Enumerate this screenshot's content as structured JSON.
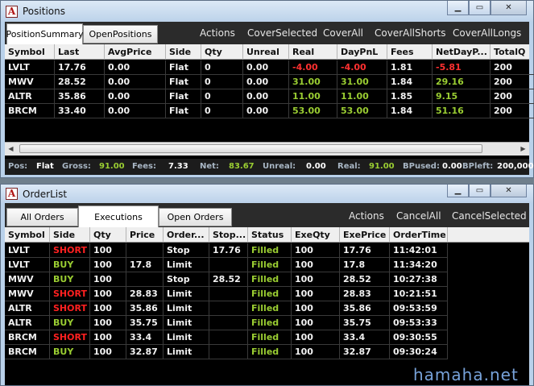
{
  "positions_window": {
    "title": "Positions",
    "tabs": [
      "PositionSummary",
      "OpenPositions"
    ],
    "actions": [
      "Actions",
      "CoverSelected",
      "CoverAll",
      "CoverAllShorts",
      "CoverAllLongs"
    ],
    "columns": [
      "Symbol",
      "Last",
      "AvgPrice",
      "Side",
      "Qty",
      "Unreal",
      "Real",
      "DayPnL",
      "Fees",
      "NetDayP...",
      "TotalQ"
    ],
    "rows": [
      [
        "LVLT",
        "17.76",
        "0.00",
        "Flat",
        "0",
        "0.00",
        "-4.00",
        "-4.00",
        "1.81",
        "-5.81",
        "200"
      ],
      [
        "MWV",
        "28.52",
        "0.00",
        "Flat",
        "0",
        "0.00",
        "31.00",
        "31.00",
        "1.84",
        "29.16",
        "200"
      ],
      [
        "ALTR",
        "35.86",
        "0.00",
        "Flat",
        "0",
        "0.00",
        "11.00",
        "11.00",
        "1.85",
        "9.15",
        "200"
      ],
      [
        "BRCM",
        "33.40",
        "0.00",
        "Flat",
        "0",
        "0.00",
        "53.00",
        "53.00",
        "1.84",
        "51.16",
        "200"
      ]
    ],
    "status": {
      "pos_label": "Pos:",
      "pos_value": "Flat",
      "gross_label": "Gross:",
      "gross_value": "91.00",
      "fees_label": "Fees:",
      "fees_value": "7.33",
      "net_label": "Net:",
      "net_value": "83.67",
      "unreal_label": "Unreal:",
      "unreal_value": "0.00",
      "real_label": "Real:",
      "real_value": "91.00",
      "bpused_label": "BPused:",
      "bpused_value": "0.00",
      "bpleft_label": "BPleft:",
      "bpleft_value": "200,000"
    }
  },
  "orders_window": {
    "title": "OrderList",
    "tabs": [
      "All Orders",
      "Executions",
      "Open Orders"
    ],
    "actions": [
      "Actions",
      "CancelAll",
      "CancelSelected"
    ],
    "columns": [
      "Symbol",
      "Side",
      "Qty",
      "Price",
      "Order...",
      "Stop...",
      "Status",
      "ExeQty",
      "ExePrice",
      "OrderTime"
    ],
    "rows": [
      [
        "LVLT",
        "SHORT",
        "100",
        "",
        "Stop",
        "17.76",
        "Filled",
        "100",
        "17.76",
        "11:42:01"
      ],
      [
        "LVLT",
        "BUY",
        "100",
        "17.8",
        "Limit",
        "",
        "Filled",
        "100",
        "17.8",
        "11:34:20"
      ],
      [
        "MWV",
        "BUY",
        "100",
        "",
        "Stop",
        "28.52",
        "Filled",
        "100",
        "28.52",
        "10:27:38"
      ],
      [
        "MWV",
        "SHORT",
        "100",
        "28.83",
        "Limit",
        "",
        "Filled",
        "100",
        "28.83",
        "10:21:51"
      ],
      [
        "ALTR",
        "SHORT",
        "100",
        "35.86",
        "Limit",
        "",
        "Filled",
        "100",
        "35.86",
        "09:53:59"
      ],
      [
        "ALTR",
        "BUY",
        "100",
        "35.75",
        "Limit",
        "",
        "Filled",
        "100",
        "35.75",
        "09:53:33"
      ],
      [
        "BRCM",
        "SHORT",
        "100",
        "33.4",
        "Limit",
        "",
        "Filled",
        "100",
        "33.4",
        "09:30:55"
      ],
      [
        "BRCM",
        "BUY",
        "100",
        "32.87",
        "Limit",
        "",
        "Filled",
        "100",
        "32.87",
        "09:30:24"
      ]
    ]
  },
  "watermark": "hamaha.net",
  "colors": {
    "negative": "#ff3030",
    "positive": "#9acd32",
    "short": "#ff2020",
    "buy": "#9acd32",
    "filled": "#9acd32",
    "grid_bg": "#000000"
  },
  "icons": {
    "app": "app-logo-icon",
    "minimize": "minimize-icon",
    "maximize": "maximize-icon",
    "close": "close-icon"
  }
}
